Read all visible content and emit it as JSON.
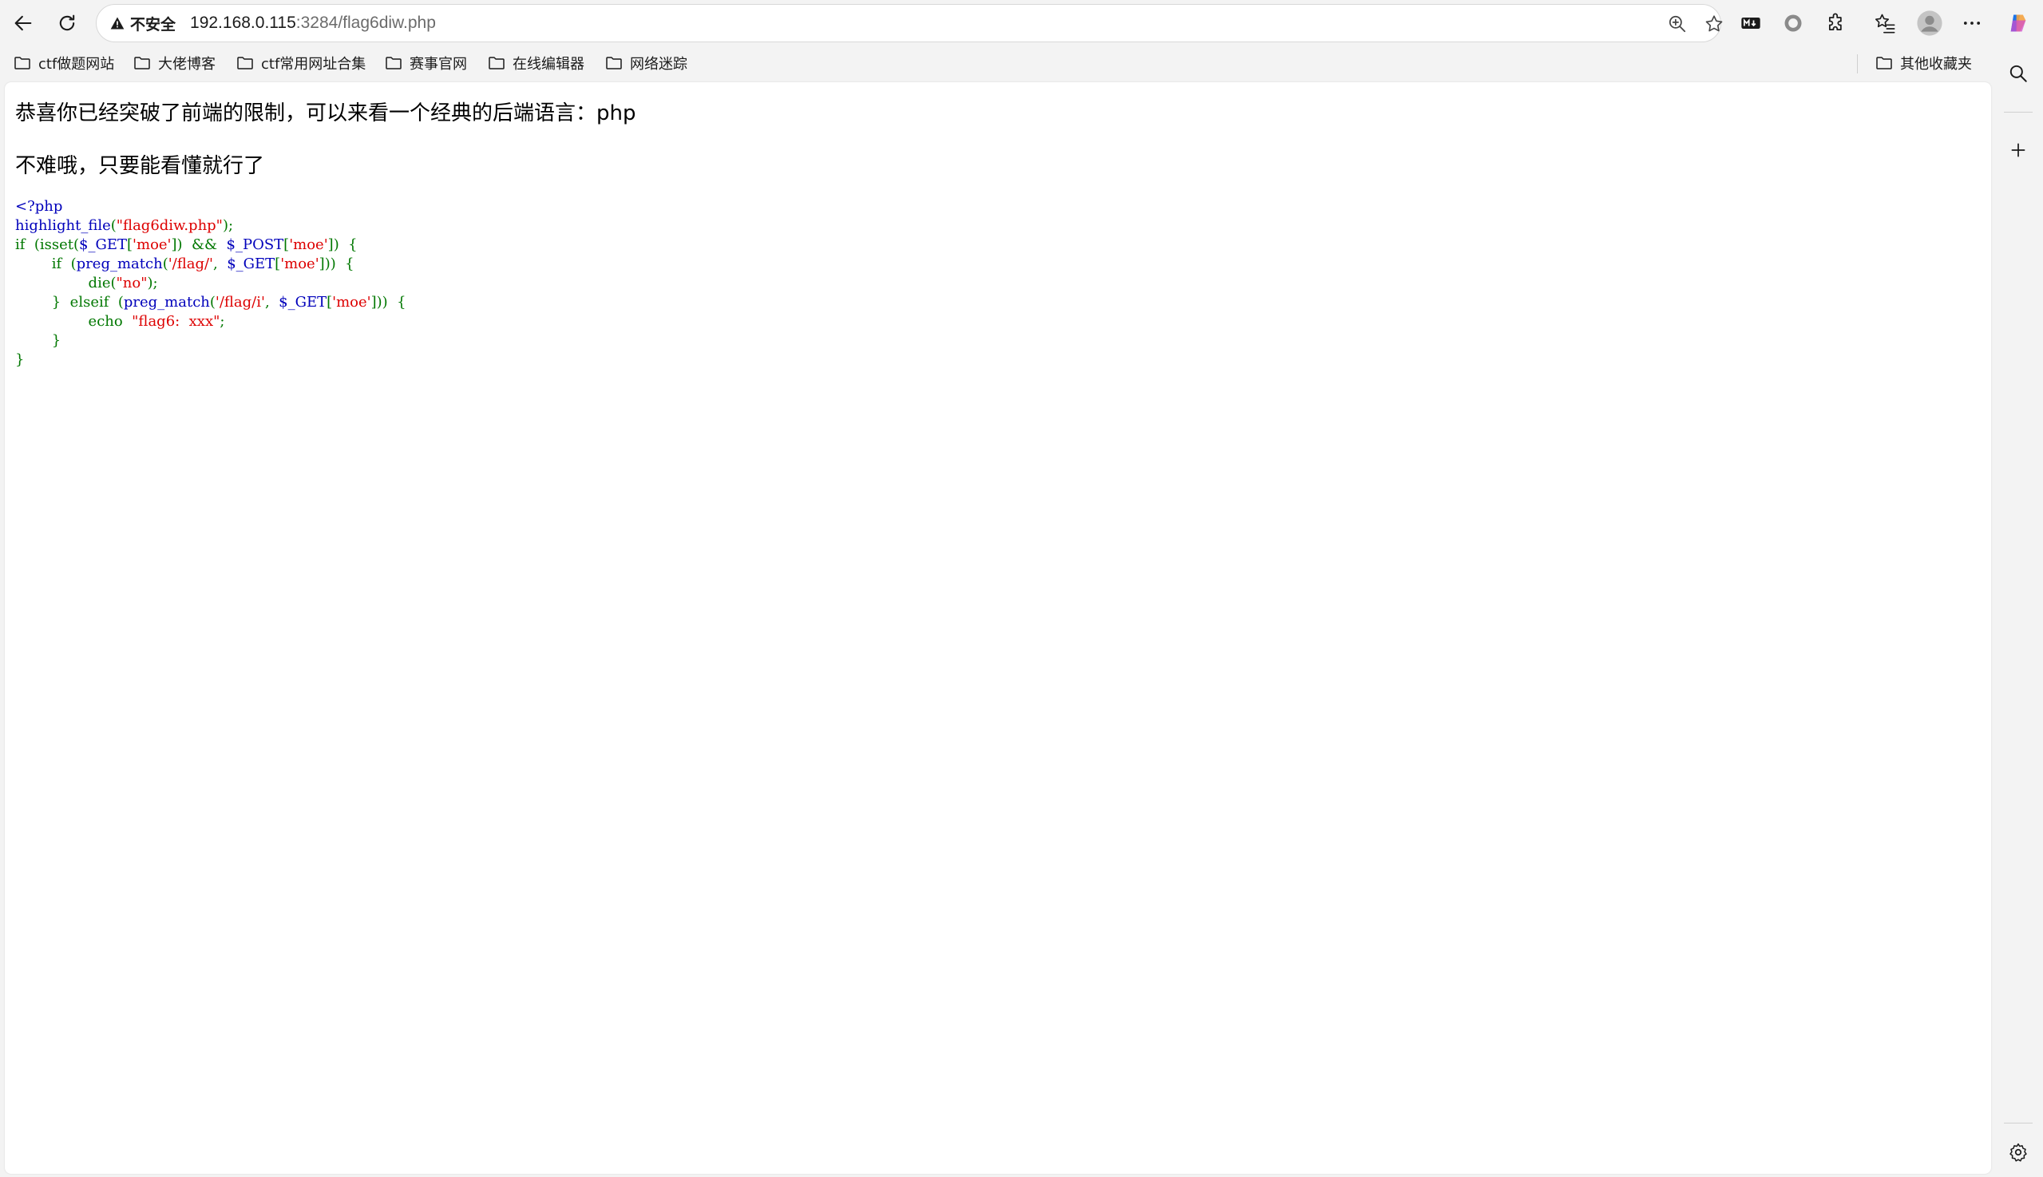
{
  "colors": {
    "php_default": "#0000BB",
    "php_keyword": "#007700",
    "php_string": "#DD0000"
  },
  "toolbar": {
    "back_icon": "arrow-left-icon",
    "reload_icon": "refresh-icon",
    "security_label": "不安全",
    "url_host": "192.168.0.115",
    "url_rest": ":3284/flag6diw.php"
  },
  "bookmarks": [
    {
      "label": "ctf做题网站"
    },
    {
      "label": "大佬博客"
    },
    {
      "label": "ctf常用网址合集"
    },
    {
      "label": "赛事官网"
    },
    {
      "label": "在线编辑器"
    },
    {
      "label": "网络迷踪"
    }
  ],
  "other_bookmarks": "其他收藏夹",
  "page": {
    "heading1": "恭喜你已经突破了前端的限制，可以来看一个经典的后端语言：php",
    "heading2": "不难哦，只要能看懂就行了",
    "code": [
      [
        {
          "t": "<?php",
          "c": "def"
        }
      ],
      [
        {
          "t": "highlight_file",
          "c": "def"
        },
        {
          "t": "(",
          "c": "kw"
        },
        {
          "t": "\"flag6diw.php\"",
          "c": "str"
        },
        {
          "t": ");",
          "c": "kw"
        }
      ],
      [
        {
          "t": "if  (isset(",
          "c": "kw"
        },
        {
          "t": "$_GET",
          "c": "def"
        },
        {
          "t": "[",
          "c": "kw"
        },
        {
          "t": "'moe'",
          "c": "str"
        },
        {
          "t": "])  &&  ",
          "c": "kw"
        },
        {
          "t": "$_POST",
          "c": "def"
        },
        {
          "t": "[",
          "c": "kw"
        },
        {
          "t": "'moe'",
          "c": "str"
        },
        {
          "t": "])  {",
          "c": "kw"
        }
      ],
      [
        {
          "t": "        if  (",
          "c": "kw"
        },
        {
          "t": "preg_match",
          "c": "def"
        },
        {
          "t": "(",
          "c": "kw"
        },
        {
          "t": "'/flag/'",
          "c": "str"
        },
        {
          "t": ",  ",
          "c": "kw"
        },
        {
          "t": "$_GET",
          "c": "def"
        },
        {
          "t": "[",
          "c": "kw"
        },
        {
          "t": "'moe'",
          "c": "str"
        },
        {
          "t": "]))  {",
          "c": "kw"
        }
      ],
      [
        {
          "t": "                die(",
          "c": "kw"
        },
        {
          "t": "\"no\"",
          "c": "str"
        },
        {
          "t": ");",
          "c": "kw"
        }
      ],
      [
        {
          "t": "        }  elseif  (",
          "c": "kw"
        },
        {
          "t": "preg_match",
          "c": "def"
        },
        {
          "t": "(",
          "c": "kw"
        },
        {
          "t": "'/flag/i'",
          "c": "str"
        },
        {
          "t": ",  ",
          "c": "kw"
        },
        {
          "t": "$_GET",
          "c": "def"
        },
        {
          "t": "[",
          "c": "kw"
        },
        {
          "t": "'moe'",
          "c": "str"
        },
        {
          "t": "]))  {",
          "c": "kw"
        }
      ],
      [
        {
          "t": "                echo  ",
          "c": "kw"
        },
        {
          "t": "\"flag6:  xxx\"",
          "c": "str"
        },
        {
          "t": ";",
          "c": "kw"
        }
      ],
      [
        {
          "t": "        }",
          "c": "kw"
        }
      ],
      [
        {
          "t": "}",
          "c": "kw"
        }
      ]
    ]
  }
}
